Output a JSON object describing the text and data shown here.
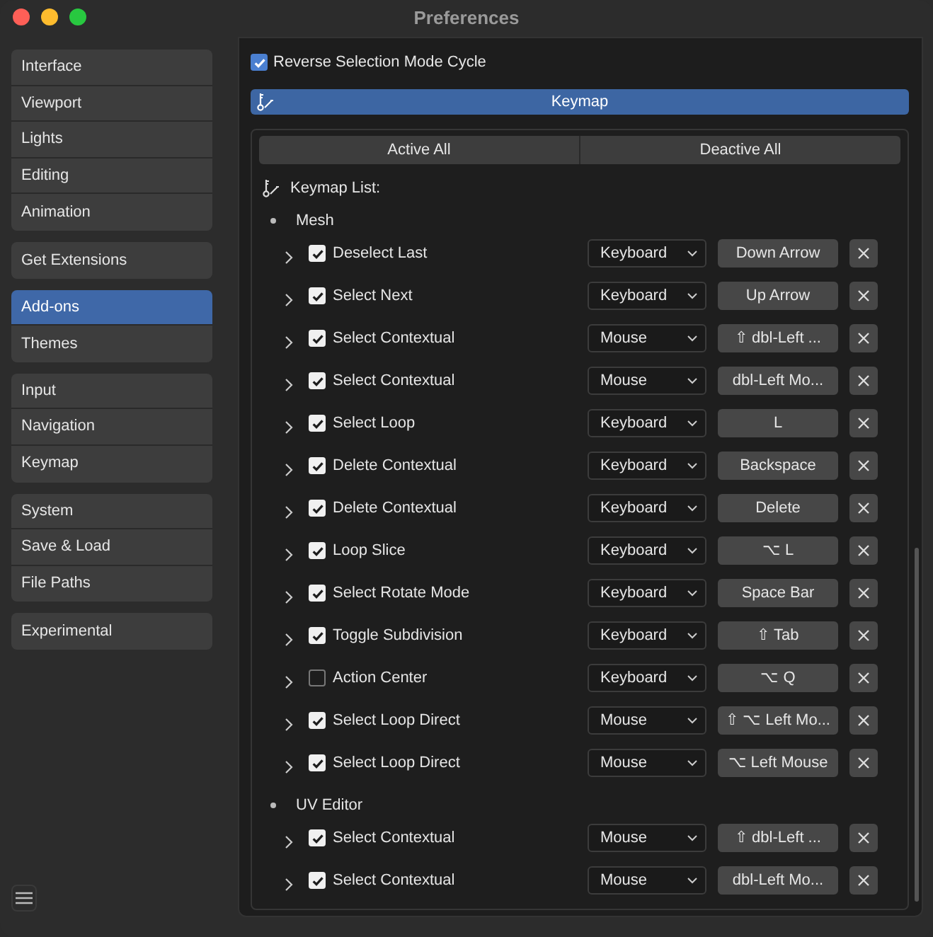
{
  "window": {
    "title": "Preferences"
  },
  "sidebar": {
    "groups": [
      [
        {
          "label": "Interface",
          "selected": false
        },
        {
          "label": "Viewport",
          "selected": false
        },
        {
          "label": "Lights",
          "selected": false
        },
        {
          "label": "Editing",
          "selected": false
        },
        {
          "label": "Animation",
          "selected": false
        }
      ],
      [
        {
          "label": "Get Extensions",
          "selected": false
        }
      ],
      [
        {
          "label": "Add-ons",
          "selected": true
        },
        {
          "label": "Themes",
          "selected": false
        }
      ],
      [
        {
          "label": "Input",
          "selected": false
        },
        {
          "label": "Navigation",
          "selected": false
        },
        {
          "label": "Keymap",
          "selected": false
        }
      ],
      [
        {
          "label": "System",
          "selected": false
        },
        {
          "label": "Save & Load",
          "selected": false
        },
        {
          "label": "File Paths",
          "selected": false
        }
      ],
      [
        {
          "label": "Experimental",
          "selected": false
        }
      ]
    ]
  },
  "option": {
    "label": "Reverse Selection Mode Cycle",
    "checked": true
  },
  "section": {
    "title": "Keymap"
  },
  "buttons": [
    "Active All",
    "Deactive All"
  ],
  "keymap_list": {
    "label": "Keymap List:",
    "groups": [
      {
        "name": "Mesh",
        "items": [
          {
            "name": "Deselect Last",
            "expanded": false,
            "enabled": true,
            "device": "Keyboard",
            "key": "Down Arrow"
          },
          {
            "name": "Select Next",
            "expanded": false,
            "enabled": true,
            "device": "Keyboard",
            "key": "Up Arrow"
          },
          {
            "name": "Select Contextual",
            "expanded": false,
            "enabled": true,
            "device": "Mouse",
            "key": "⇧ dbl-Left ..."
          },
          {
            "name": "Select Contextual",
            "expanded": false,
            "enabled": true,
            "device": "Mouse",
            "key": "dbl-Left Mo..."
          },
          {
            "name": "Select Loop",
            "expanded": false,
            "enabled": true,
            "device": "Keyboard",
            "key": "L"
          },
          {
            "name": "Delete Contextual",
            "expanded": false,
            "enabled": true,
            "device": "Keyboard",
            "key": "Backspace"
          },
          {
            "name": "Delete Contextual",
            "expanded": false,
            "enabled": true,
            "device": "Keyboard",
            "key": "Delete"
          },
          {
            "name": "Loop Slice",
            "expanded": false,
            "enabled": true,
            "device": "Keyboard",
            "key": "⌥ L"
          },
          {
            "name": "Select Rotate Mode",
            "expanded": false,
            "enabled": true,
            "device": "Keyboard",
            "key": "Space Bar"
          },
          {
            "name": "Toggle Subdivision",
            "expanded": false,
            "enabled": true,
            "device": "Keyboard",
            "key": "⇧ Tab"
          },
          {
            "name": "Action Center",
            "expanded": false,
            "enabled": false,
            "device": "Keyboard",
            "key": "⌥ Q"
          },
          {
            "name": "Select Loop Direct",
            "expanded": false,
            "enabled": true,
            "device": "Mouse",
            "key": "⇧ ⌥ Left Mo..."
          },
          {
            "name": "Select Loop Direct",
            "expanded": false,
            "enabled": true,
            "device": "Mouse",
            "key": "⌥ Left Mouse"
          }
        ]
      },
      {
        "name": "UV Editor",
        "items": [
          {
            "name": "Select Contextual",
            "expanded": false,
            "enabled": true,
            "device": "Mouse",
            "key": "⇧ dbl-Left ..."
          },
          {
            "name": "Select Contextual",
            "expanded": false,
            "enabled": true,
            "device": "Mouse",
            "key": "dbl-Left Mo..."
          }
        ]
      }
    ]
  }
}
